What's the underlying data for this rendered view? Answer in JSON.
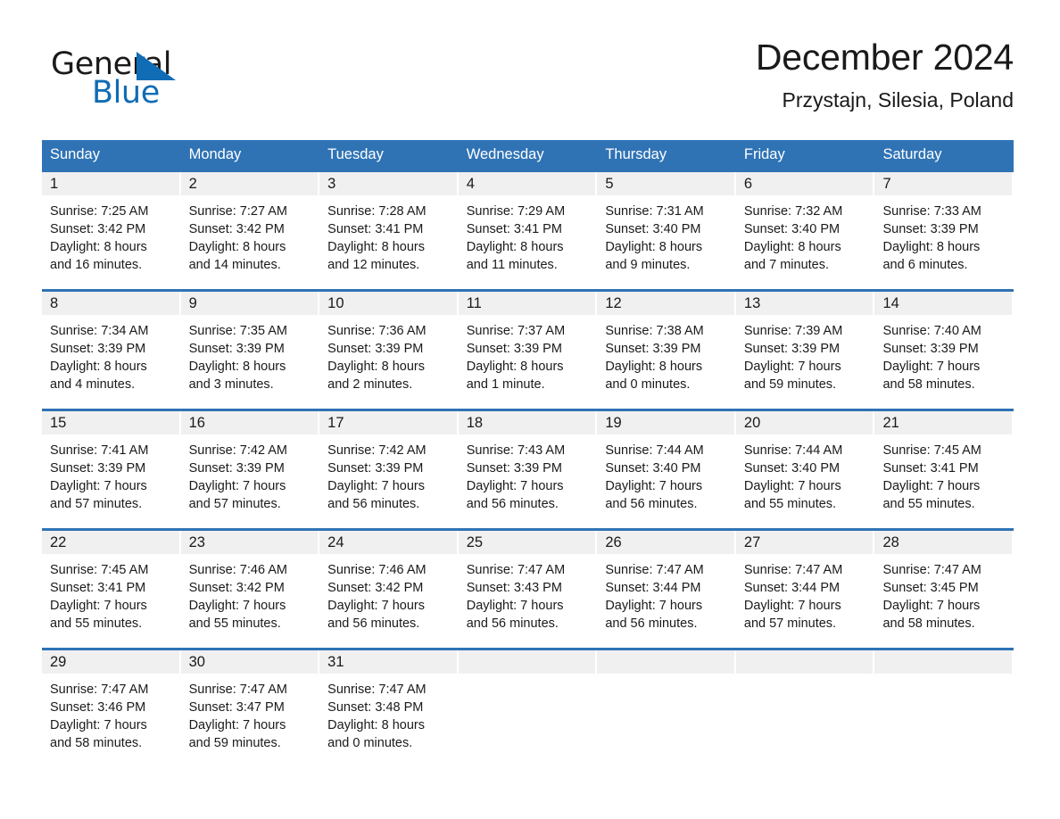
{
  "brand": {
    "name_part1": "General",
    "name_part2": "Blue",
    "logo_icon": "triangle-icon",
    "accent_color": "#106cb5"
  },
  "header": {
    "title": "December 2024",
    "subtitle": "Przystajn, Silesia, Poland"
  },
  "calendar": {
    "header_bg": "#2f73b5",
    "daynum_band_bg": "#f0f0f0",
    "weekdays": [
      "Sunday",
      "Monday",
      "Tuesday",
      "Wednesday",
      "Thursday",
      "Friday",
      "Saturday"
    ],
    "weeks": [
      [
        {
          "day": "1",
          "sunrise": "Sunrise: 7:25 AM",
          "sunset": "Sunset: 3:42 PM",
          "daylight1": "Daylight: 8 hours",
          "daylight2": "and 16 minutes."
        },
        {
          "day": "2",
          "sunrise": "Sunrise: 7:27 AM",
          "sunset": "Sunset: 3:42 PM",
          "daylight1": "Daylight: 8 hours",
          "daylight2": "and 14 minutes."
        },
        {
          "day": "3",
          "sunrise": "Sunrise: 7:28 AM",
          "sunset": "Sunset: 3:41 PM",
          "daylight1": "Daylight: 8 hours",
          "daylight2": "and 12 minutes."
        },
        {
          "day": "4",
          "sunrise": "Sunrise: 7:29 AM",
          "sunset": "Sunset: 3:41 PM",
          "daylight1": "Daylight: 8 hours",
          "daylight2": "and 11 minutes."
        },
        {
          "day": "5",
          "sunrise": "Sunrise: 7:31 AM",
          "sunset": "Sunset: 3:40 PM",
          "daylight1": "Daylight: 8 hours",
          "daylight2": "and 9 minutes."
        },
        {
          "day": "6",
          "sunrise": "Sunrise: 7:32 AM",
          "sunset": "Sunset: 3:40 PM",
          "daylight1": "Daylight: 8 hours",
          "daylight2": "and 7 minutes."
        },
        {
          "day": "7",
          "sunrise": "Sunrise: 7:33 AM",
          "sunset": "Sunset: 3:39 PM",
          "daylight1": "Daylight: 8 hours",
          "daylight2": "and 6 minutes."
        }
      ],
      [
        {
          "day": "8",
          "sunrise": "Sunrise: 7:34 AM",
          "sunset": "Sunset: 3:39 PM",
          "daylight1": "Daylight: 8 hours",
          "daylight2": "and 4 minutes."
        },
        {
          "day": "9",
          "sunrise": "Sunrise: 7:35 AM",
          "sunset": "Sunset: 3:39 PM",
          "daylight1": "Daylight: 8 hours",
          "daylight2": "and 3 minutes."
        },
        {
          "day": "10",
          "sunrise": "Sunrise: 7:36 AM",
          "sunset": "Sunset: 3:39 PM",
          "daylight1": "Daylight: 8 hours",
          "daylight2": "and 2 minutes."
        },
        {
          "day": "11",
          "sunrise": "Sunrise: 7:37 AM",
          "sunset": "Sunset: 3:39 PM",
          "daylight1": "Daylight: 8 hours",
          "daylight2": "and 1 minute."
        },
        {
          "day": "12",
          "sunrise": "Sunrise: 7:38 AM",
          "sunset": "Sunset: 3:39 PM",
          "daylight1": "Daylight: 8 hours",
          "daylight2": "and 0 minutes."
        },
        {
          "day": "13",
          "sunrise": "Sunrise: 7:39 AM",
          "sunset": "Sunset: 3:39 PM",
          "daylight1": "Daylight: 7 hours",
          "daylight2": "and 59 minutes."
        },
        {
          "day": "14",
          "sunrise": "Sunrise: 7:40 AM",
          "sunset": "Sunset: 3:39 PM",
          "daylight1": "Daylight: 7 hours",
          "daylight2": "and 58 minutes."
        }
      ],
      [
        {
          "day": "15",
          "sunrise": "Sunrise: 7:41 AM",
          "sunset": "Sunset: 3:39 PM",
          "daylight1": "Daylight: 7 hours",
          "daylight2": "and 57 minutes."
        },
        {
          "day": "16",
          "sunrise": "Sunrise: 7:42 AM",
          "sunset": "Sunset: 3:39 PM",
          "daylight1": "Daylight: 7 hours",
          "daylight2": "and 57 minutes."
        },
        {
          "day": "17",
          "sunrise": "Sunrise: 7:42 AM",
          "sunset": "Sunset: 3:39 PM",
          "daylight1": "Daylight: 7 hours",
          "daylight2": "and 56 minutes."
        },
        {
          "day": "18",
          "sunrise": "Sunrise: 7:43 AM",
          "sunset": "Sunset: 3:39 PM",
          "daylight1": "Daylight: 7 hours",
          "daylight2": "and 56 minutes."
        },
        {
          "day": "19",
          "sunrise": "Sunrise: 7:44 AM",
          "sunset": "Sunset: 3:40 PM",
          "daylight1": "Daylight: 7 hours",
          "daylight2": "and 56 minutes."
        },
        {
          "day": "20",
          "sunrise": "Sunrise: 7:44 AM",
          "sunset": "Sunset: 3:40 PM",
          "daylight1": "Daylight: 7 hours",
          "daylight2": "and 55 minutes."
        },
        {
          "day": "21",
          "sunrise": "Sunrise: 7:45 AM",
          "sunset": "Sunset: 3:41 PM",
          "daylight1": "Daylight: 7 hours",
          "daylight2": "and 55 minutes."
        }
      ],
      [
        {
          "day": "22",
          "sunrise": "Sunrise: 7:45 AM",
          "sunset": "Sunset: 3:41 PM",
          "daylight1": "Daylight: 7 hours",
          "daylight2": "and 55 minutes."
        },
        {
          "day": "23",
          "sunrise": "Sunrise: 7:46 AM",
          "sunset": "Sunset: 3:42 PM",
          "daylight1": "Daylight: 7 hours",
          "daylight2": "and 55 minutes."
        },
        {
          "day": "24",
          "sunrise": "Sunrise: 7:46 AM",
          "sunset": "Sunset: 3:42 PM",
          "daylight1": "Daylight: 7 hours",
          "daylight2": "and 56 minutes."
        },
        {
          "day": "25",
          "sunrise": "Sunrise: 7:47 AM",
          "sunset": "Sunset: 3:43 PM",
          "daylight1": "Daylight: 7 hours",
          "daylight2": "and 56 minutes."
        },
        {
          "day": "26",
          "sunrise": "Sunrise: 7:47 AM",
          "sunset": "Sunset: 3:44 PM",
          "daylight1": "Daylight: 7 hours",
          "daylight2": "and 56 minutes."
        },
        {
          "day": "27",
          "sunrise": "Sunrise: 7:47 AM",
          "sunset": "Sunset: 3:44 PM",
          "daylight1": "Daylight: 7 hours",
          "daylight2": "and 57 minutes."
        },
        {
          "day": "28",
          "sunrise": "Sunrise: 7:47 AM",
          "sunset": "Sunset: 3:45 PM",
          "daylight1": "Daylight: 7 hours",
          "daylight2": "and 58 minutes."
        }
      ],
      [
        {
          "day": "29",
          "sunrise": "Sunrise: 7:47 AM",
          "sunset": "Sunset: 3:46 PM",
          "daylight1": "Daylight: 7 hours",
          "daylight2": "and 58 minutes."
        },
        {
          "day": "30",
          "sunrise": "Sunrise: 7:47 AM",
          "sunset": "Sunset: 3:47 PM",
          "daylight1": "Daylight: 7 hours",
          "daylight2": "and 59 minutes."
        },
        {
          "day": "31",
          "sunrise": "Sunrise: 7:47 AM",
          "sunset": "Sunset: 3:48 PM",
          "daylight1": "Daylight: 8 hours",
          "daylight2": "and 0 minutes."
        },
        {
          "day": "",
          "sunrise": "",
          "sunset": "",
          "daylight1": "",
          "daylight2": ""
        },
        {
          "day": "",
          "sunrise": "",
          "sunset": "",
          "daylight1": "",
          "daylight2": ""
        },
        {
          "day": "",
          "sunrise": "",
          "sunset": "",
          "daylight1": "",
          "daylight2": ""
        },
        {
          "day": "",
          "sunrise": "",
          "sunset": "",
          "daylight1": "",
          "daylight2": ""
        }
      ]
    ]
  }
}
